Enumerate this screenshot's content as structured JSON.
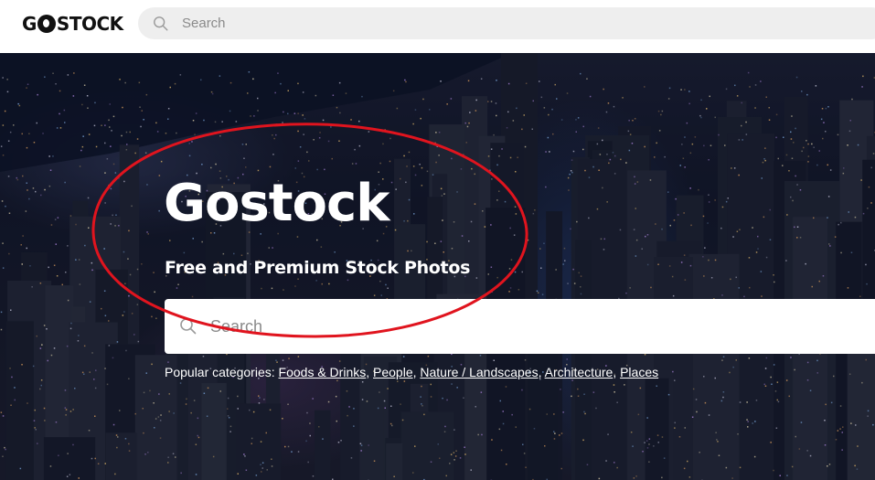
{
  "header": {
    "logo_text_left": "G",
    "logo_text_right": "STOCK",
    "search_placeholder": "Search"
  },
  "hero": {
    "title": "Gostock",
    "subtitle": "Free and Premium Stock Photos",
    "search_placeholder": "Search",
    "popular_label": "Popular categories:",
    "categories": [
      "Foods & Drinks",
      "People",
      "Nature / Landscapes",
      "Architecture",
      "Places"
    ]
  },
  "annotation": {
    "color": "#e0141e"
  },
  "icons": {
    "search": "search-icon",
    "logo_mark": "logo-o-icon"
  }
}
